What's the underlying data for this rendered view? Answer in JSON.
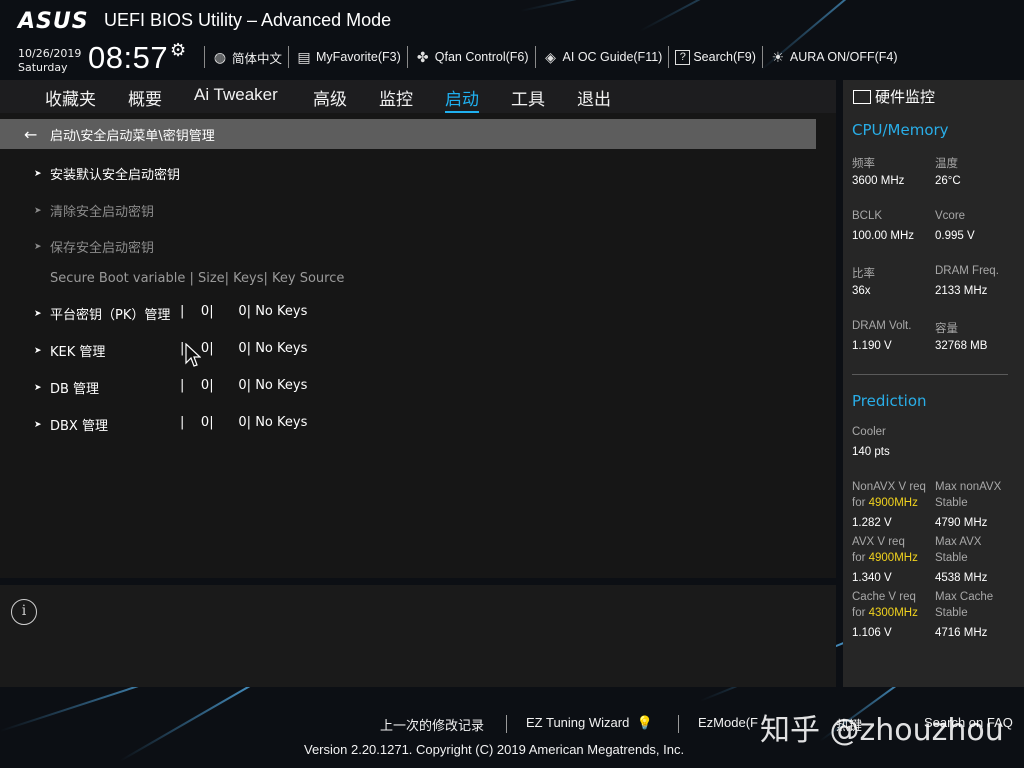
{
  "header": {
    "logo": "ASUS",
    "title": "UEFI BIOS Utility – Advanced Mode",
    "date": "10/26/2019",
    "day": "Saturday",
    "time": "08:57",
    "settings_icon": "gear-icon",
    "toolbar": [
      {
        "icon": "globe-icon",
        "label": "简体中文"
      },
      {
        "icon": "favorite-list-icon",
        "label": "MyFavorite(F3)"
      },
      {
        "icon": "fan-icon",
        "label": "Qfan Control(F6)"
      },
      {
        "icon": "ai-oc-icon",
        "label": "AI OC Guide(F11)"
      },
      {
        "icon": "search-question-icon",
        "label": "Search(F9)"
      },
      {
        "icon": "aura-light-icon",
        "label": "AURA ON/OFF(F4)"
      }
    ]
  },
  "nav": {
    "items": [
      "收藏夹",
      "概要",
      "Ai Tweaker",
      "高级",
      "监控",
      "启动",
      "工具",
      "退出"
    ],
    "active": "启动"
  },
  "main": {
    "breadcrumb": "启动\\安全启动菜单\\密钥管理",
    "actions": [
      {
        "label": "安装默认安全启动密钥",
        "enabled": true
      },
      {
        "label": "清除安全启动密钥",
        "enabled": false
      },
      {
        "label": "保存安全启动密钥",
        "enabled": false
      }
    ],
    "table_header": "Secure Boot variable | Size| Keys| Key Source",
    "keys": [
      {
        "name": "平台密钥（PK）管理",
        "size": "0",
        "keys": "0",
        "source": "No Keys"
      },
      {
        "name": "KEK 管理",
        "size": "0",
        "keys": "0",
        "source": "No Keys"
      },
      {
        "name": "DB 管理",
        "size": "0",
        "keys": "0",
        "source": "No Keys"
      },
      {
        "name": "DBX 管理",
        "size": "0",
        "keys": "0",
        "source": "No Keys"
      }
    ]
  },
  "help": {
    "icon": "info-icon",
    "info_glyph": "i"
  },
  "hw_monitor": {
    "title": "硬件监控",
    "cpu_section": "CPU/Memory",
    "cpu": [
      {
        "label": "频率",
        "value": "3600 MHz"
      },
      {
        "label": "温度",
        "value": "26°C"
      },
      {
        "label": "BCLK",
        "value": "100.00 MHz"
      },
      {
        "label": "Vcore",
        "value": "0.995 V"
      },
      {
        "label": "比率",
        "value": "36x"
      },
      {
        "label": "DRAM Freq.",
        "value": "2133 MHz"
      },
      {
        "label": "DRAM Volt.",
        "value": "1.190 V"
      },
      {
        "label": "容量",
        "value": "32768 MB"
      }
    ],
    "prediction_section": "Prediction",
    "cooler_label": "Cooler",
    "cooler_value": "140 pts",
    "predictions": [
      {
        "left_label": "NonAVX V req",
        "left_for": "for ",
        "left_freq": "4900MHz",
        "left_value": "1.282 V",
        "right_label": "Max nonAVX",
        "right_sub": "Stable",
        "right_value": "4790 MHz"
      },
      {
        "left_label": "AVX V req",
        "left_for": "for ",
        "left_freq": "4900MHz",
        "left_value": "1.340 V",
        "right_label": "Max AVX",
        "right_sub": "Stable",
        "right_value": "4538 MHz"
      },
      {
        "left_label": "Cache V req",
        "left_for": "for ",
        "left_freq": "4300MHz",
        "left_value": "1.106 V",
        "right_label": "Max Cache",
        "right_sub": "Stable",
        "right_value": "4716 MHz"
      }
    ]
  },
  "footer": {
    "last_modified": "上一次的修改记录",
    "ez_tuning": "EZ Tuning Wizard",
    "ezmode": "EzMode(F",
    "hotkeys": "热键",
    "search_faq": "Search on FAQ",
    "copyright": "Version 2.20.1271. Copyright (C) 2019 American Megatrends, Inc.",
    "watermark": "知乎 @zhouzhou"
  },
  "colors": {
    "accent": "#1fb0f0",
    "highlight": "#f0d21e",
    "breadcrumb_bg": "#5d5d5d",
    "panel_bg": "#161616"
  }
}
